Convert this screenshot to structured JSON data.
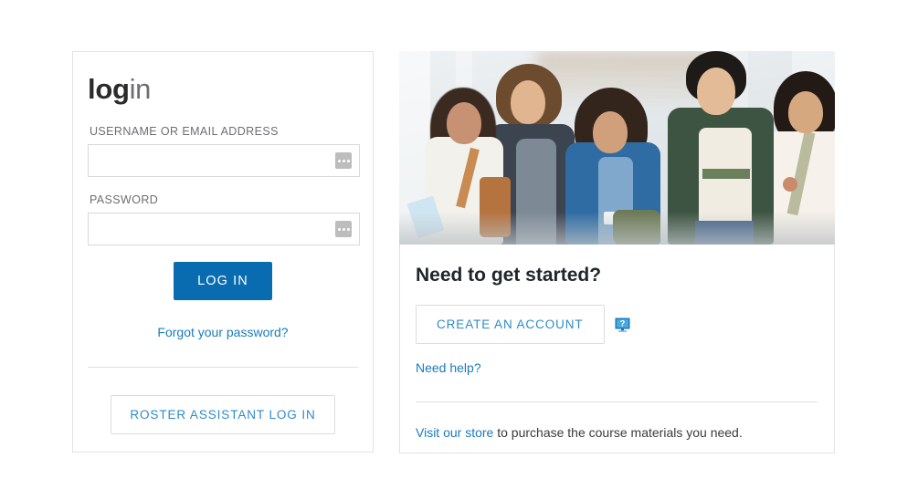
{
  "login_panel": {
    "title_bold": "log",
    "title_light": "in",
    "username": {
      "label": "USERNAME OR EMAIL ADDRESS",
      "value": "",
      "placeholder": "",
      "autofill_icon": "ellipsis-badge-icon"
    },
    "password": {
      "label": "PASSWORD",
      "value": "",
      "placeholder": "",
      "autofill_icon": "ellipsis-badge-icon"
    },
    "login_button": "LOG IN",
    "forgot_link": "Forgot your password?",
    "roster_button": "ROSTER ASSISTANT LOG IN"
  },
  "info_panel": {
    "hero_alt": "students-walking-photo",
    "title": "Need to get started?",
    "create_account_button": "CREATE AN ACCOUNT",
    "help_icon": "monitor-question-help-icon",
    "need_help_link": "Need help?",
    "store_link": "Visit our store",
    "store_text": " to purchase the course materials you need."
  },
  "colors": {
    "primary_blue": "#0a6cb0",
    "link_blue": "#1a7bbd",
    "button_link_blue": "#2e8bc9",
    "label_gray": "#6d6e71",
    "title_dark": "#2b2b2b",
    "border_gray": "#e3e3e3",
    "input_border": "#d8d8d8",
    "divider": "#e0e0e0"
  }
}
